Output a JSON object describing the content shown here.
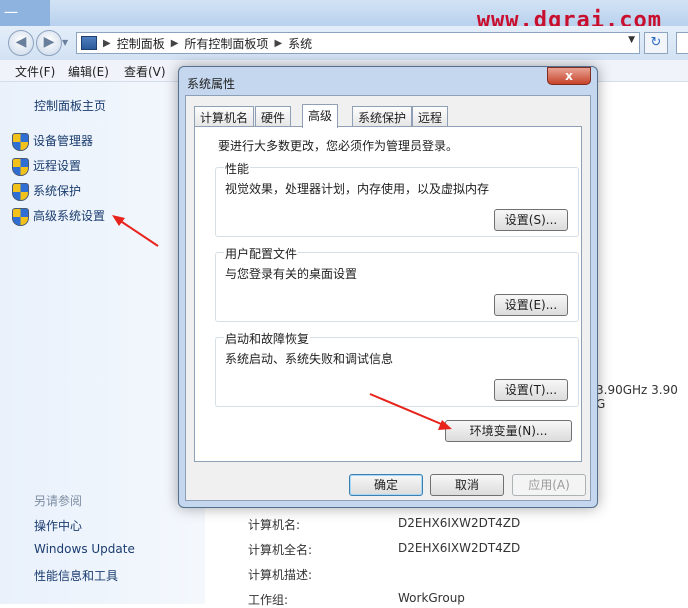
{
  "window": {
    "title_fragment": "一"
  },
  "watermark": "www.dgrai.com",
  "nav": {
    "breadcrumbs": [
      "控制面板",
      "所有控制面板项",
      "系统"
    ],
    "refresh_glyph": "↻"
  },
  "menu": [
    "文件(F)",
    "编辑(E)",
    "查看(V)"
  ],
  "sidebar": {
    "home": "控制面板主页",
    "links": [
      "设备管理器",
      "远程设置",
      "系统保护",
      "高级系统设置"
    ],
    "see_also_title": "另请参阅",
    "see_also": [
      "操作中心",
      "Windows Update",
      "性能信息和工具"
    ]
  },
  "system_info": {
    "cpu_text": "3.90GHz   3.90 G",
    "rows": [
      {
        "label": "计算机名:",
        "value": "D2EHX6IXW2DT4ZD"
      },
      {
        "label": "计算机全名:",
        "value": "D2EHX6IXW2DT4ZD"
      },
      {
        "label": "计算机描述:",
        "value": ""
      },
      {
        "label": "工作组:",
        "value": "WorkGroup"
      }
    ]
  },
  "dialog": {
    "title": "系统属性",
    "close_glyph": "x",
    "tabs": [
      "计算机名",
      "硬件",
      "高级",
      "系统保护",
      "远程"
    ],
    "active_tab": "高级",
    "intro": "要进行大多数更改，您必须作为管理员登录。",
    "groups": [
      {
        "title": "性能",
        "desc": "视觉效果，处理器计划，内存使用，以及虚拟内存",
        "button": "设置(S)..."
      },
      {
        "title": "用户配置文件",
        "desc": "与您登录有关的桌面设置",
        "button": "设置(E)..."
      },
      {
        "title": "启动和故障恢复",
        "desc": "系统启动、系统失败和调试信息",
        "button": "设置(T)..."
      }
    ],
    "env_button": "环境变量(N)...",
    "ok": "确定",
    "cancel": "取消",
    "apply": "应用(A)"
  },
  "colors": {
    "annotation_arrow": "#e8231c",
    "link": "#1a3c6e",
    "watermark": "#c8102e"
  }
}
